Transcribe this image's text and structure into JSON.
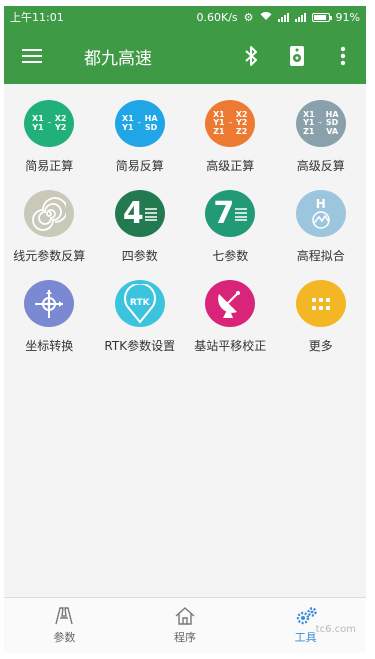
{
  "status_bar": {
    "time": "上午11:01",
    "network_speed": "0.60K/s",
    "battery": "91%",
    "battery_level": 0.91
  },
  "app_bar": {
    "title": "都九高速",
    "icons": [
      "menu-icon",
      "bluetooth-icon",
      "speaker-icon",
      "more-vert-icon"
    ]
  },
  "colors": {
    "primary": "#3f9a46",
    "active_tab": "#3a8fd8"
  },
  "tools": [
    {
      "label": "简易正算",
      "color": "#21b07a",
      "glyph": [
        "X1",
        "Y1",
        "→",
        "X2",
        "Y2"
      ]
    },
    {
      "label": "简易反算",
      "color": "#20a6e6",
      "glyph": [
        "X1",
        "Y1",
        "→",
        "HA",
        "SD"
      ]
    },
    {
      "label": "高级正算",
      "color": "#ec7a33",
      "glyph": [
        "X1",
        "Y1",
        "Z1",
        "X2",
        "Y2",
        "Z2"
      ]
    },
    {
      "label": "高级反算",
      "color": "#8aa0ab",
      "glyph": [
        "X1",
        "Y1",
        "Z1",
        "HA",
        "SD",
        "VA"
      ]
    },
    {
      "label": "线元参数反算",
      "color": "#c9c9b9",
      "glyph": [
        "spiral-icon"
      ]
    },
    {
      "label": "四参数",
      "color": "#247a50",
      "glyph": [
        "4"
      ]
    },
    {
      "label": "七参数",
      "color": "#239a76",
      "glyph": [
        "7"
      ]
    },
    {
      "label": "高程拟合",
      "color": "#9cc6dd",
      "glyph": [
        "H"
      ]
    },
    {
      "label": "坐标转换",
      "color": "#7b88d2",
      "glyph": [
        "axes-icon"
      ]
    },
    {
      "label": "RTK参数设置",
      "color": "#3cc3de",
      "glyph": [
        "RTK"
      ]
    },
    {
      "label": "基站平移校正",
      "color": "#d8257a",
      "glyph": [
        "dish-icon"
      ]
    },
    {
      "label": "更多",
      "color": "#f3b624",
      "glyph": [
        "dots-icon"
      ]
    }
  ],
  "tabs": [
    {
      "label": "参数",
      "icon": "parameter-icon",
      "active": false
    },
    {
      "label": "程序",
      "icon": "home-icon",
      "active": false
    },
    {
      "label": "工具",
      "icon": "gears-icon",
      "active": true
    }
  ],
  "watermark": "tc6.com"
}
